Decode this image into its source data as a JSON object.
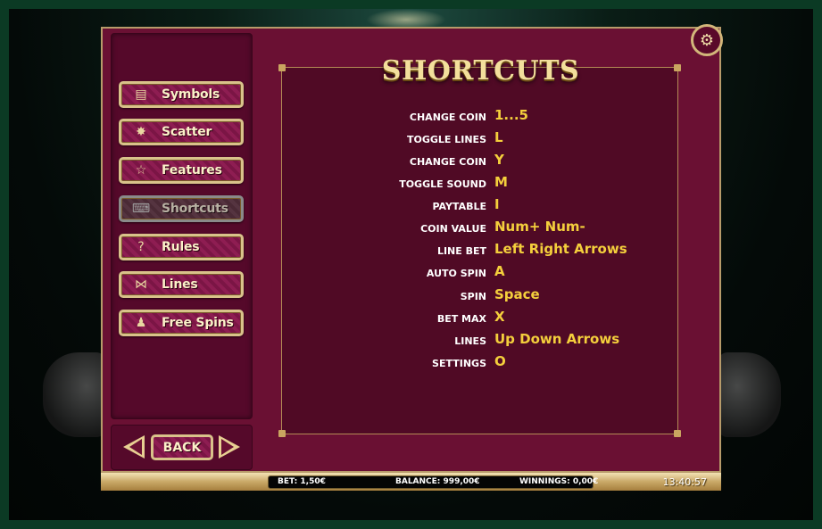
{
  "page": {
    "title": "SHORTCUTS"
  },
  "sidebar": {
    "items": [
      {
        "label": "Symbols",
        "icon": "symbols-icon",
        "glyph": "▤",
        "active": false
      },
      {
        "label": "Scatter",
        "icon": "scatter-icon",
        "glyph": "✸",
        "active": false
      },
      {
        "label": "Features",
        "icon": "star-icon",
        "glyph": "☆",
        "active": false
      },
      {
        "label": "Shortcuts",
        "icon": "keyboard-icon",
        "glyph": "⌨",
        "active": true
      },
      {
        "label": "Rules",
        "icon": "question-icon",
        "glyph": "?",
        "active": false
      },
      {
        "label": "Lines",
        "icon": "lines-icon",
        "glyph": "⋈",
        "active": false
      },
      {
        "label": "Free Spins",
        "icon": "joystick-icon",
        "glyph": "♟",
        "active": false
      }
    ],
    "back_label": "BACK"
  },
  "shortcuts": [
    {
      "key": "CHANGE COIN",
      "value": "1...5"
    },
    {
      "key": "TOGGLE LINES",
      "value": "L"
    },
    {
      "key": "CHANGE COIN",
      "value": "Y"
    },
    {
      "key": "TOGGLE SOUND",
      "value": "M"
    },
    {
      "key": "PAYTABLE",
      "value": "I"
    },
    {
      "key": "COIN VALUE",
      "value": "Num+ Num-"
    },
    {
      "key": "LINE BET",
      "value": "Left Right Arrows"
    },
    {
      "key": "AUTO SPIN",
      "value": "A"
    },
    {
      "key": "SPIN",
      "value": "Space"
    },
    {
      "key": "BET MAX",
      "value": "X"
    },
    {
      "key": "LINES",
      "value": "Up Down Arrows"
    },
    {
      "key": "SETTINGS",
      "value": "O"
    }
  ],
  "status": {
    "bet": "BET: 1,50€",
    "balance": "BALANCE: 999,00€",
    "winnings": "WINNINGS: 0,00€",
    "clock": "13:40:57"
  },
  "settings": {
    "icon": "gear-icon",
    "glyph": "⚙"
  },
  "colors": {
    "panel": "#6a1033",
    "gold": "#d9c28a",
    "value_yellow": "#f4cf3c",
    "title_gold": "#f3df9c"
  }
}
